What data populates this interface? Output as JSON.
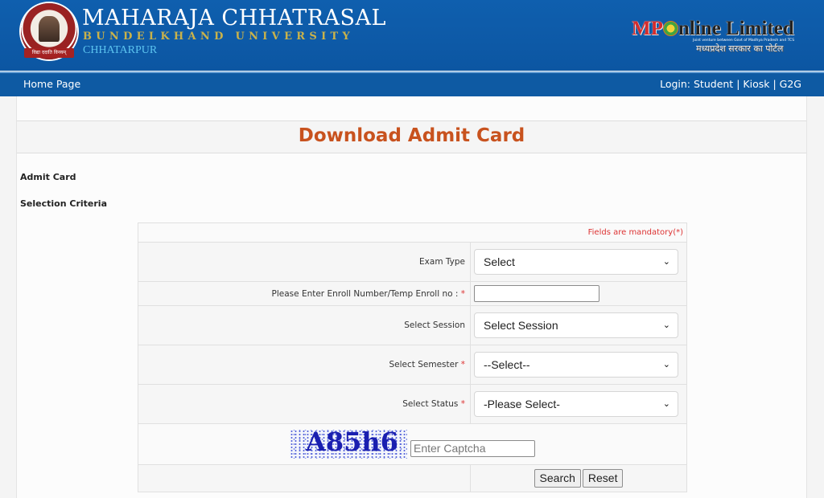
{
  "header": {
    "logo_alt": "university-emblem",
    "logo_ribbon_text": "विद्या ददाति विनयम्",
    "university_name": "MAHARAJA CHHATRASAL",
    "university_subtitle": "BUNDELKHAND UNIVERSITY",
    "university_city": "CHHATARPUR",
    "partner": {
      "prefix": "MP",
      "suffix": "nline Limited",
      "tagline": "Joint venture between Govt of Madhya Pradesh and TCS",
      "hindi": "मध्यप्रदेश सरकार का पोर्टल"
    }
  },
  "nav": {
    "home": "Home Page",
    "login_prefix": "Login:",
    "links": [
      "Student",
      "Kiosk",
      "G2G"
    ],
    "separator": "|"
  },
  "page": {
    "title": "Download Admit Card",
    "section_admit": "Admit Card",
    "section_criteria": "Selection Criteria"
  },
  "form": {
    "mandatory_note": "Fields are mandatory(*)",
    "fields": {
      "exam_type": {
        "label": "Exam Type",
        "value": "Select",
        "required": false
      },
      "enroll": {
        "label": "Please Enter Enroll Number/Temp Enroll no :",
        "value": "",
        "required": true
      },
      "session": {
        "label": "Select Session",
        "value": "Select Session",
        "required": false
      },
      "semester": {
        "label": "Select Semester",
        "value": "--Select--",
        "required": true
      },
      "status": {
        "label": "Select Status",
        "value": "-Please Select-",
        "required": true
      }
    },
    "required_mark": "*",
    "captcha": {
      "text": "A85h6",
      "placeholder": "Enter Captcha",
      "value": ""
    },
    "buttons": {
      "search": "Search",
      "reset": "Reset"
    }
  },
  "icons": {
    "chevron": "❯"
  }
}
